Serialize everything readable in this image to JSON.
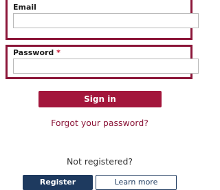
{
  "form": {
    "email_label": "Email",
    "email_value": "",
    "password_label": "Password",
    "password_required_mark": "*",
    "password_value": "",
    "sign_in_label": "Sign in",
    "forgot_password_label": "Forgot your password?"
  },
  "registration": {
    "prompt": "Not registered?",
    "register_label": "Register",
    "learn_more_label": "Learn more"
  },
  "colors": {
    "accent": "#8b1538",
    "sign_in_button": "#a3163c",
    "navy": "#1e3a5f"
  }
}
